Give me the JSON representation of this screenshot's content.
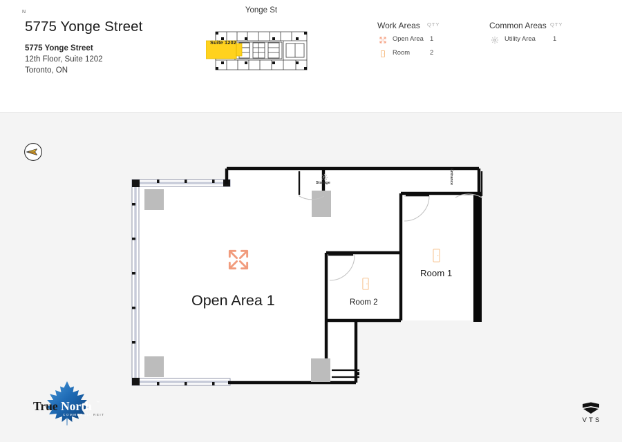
{
  "header": {
    "property_title": "5775 Yonge Street",
    "address": {
      "line1": "5775 Yonge Street",
      "line2": "12th Floor, Suite 1202",
      "line3": "Toronto, ON"
    }
  },
  "keyplan": {
    "title": "Yonge St",
    "highlight_label": "Suite 1202",
    "highlight_color": "#FFD21E"
  },
  "legends": [
    {
      "id": "work-areas",
      "title": "Work Areas",
      "qty_header": "QTY",
      "rows": [
        {
          "icon": "expand-arrows-icon",
          "label": "Open Area",
          "qty": "1",
          "color": "#F5A183"
        },
        {
          "icon": "door-room-icon",
          "label": "Room",
          "qty": "2",
          "color": "#F7C08A"
        }
      ]
    },
    {
      "id": "common-areas",
      "title": "Common Areas",
      "qty_header": "QTY",
      "rows": [
        {
          "icon": "gear-icon",
          "label": "Utility Area",
          "qty": "1",
          "color": "#9a9a9a"
        }
      ]
    }
  ],
  "compass": {
    "label": "N"
  },
  "floorplan": {
    "spaces": [
      {
        "name": "Open Area 1",
        "icon": "expand-arrows-icon",
        "type": "open-area"
      },
      {
        "name": "Room 1",
        "icon": "door-room-icon",
        "type": "room"
      },
      {
        "name": "Room 2",
        "icon": "door-room-icon",
        "type": "room"
      },
      {
        "name": "Storage",
        "icon": "gear-icon",
        "type": "utility-area"
      }
    ],
    "entrance_label": "Entrance"
  },
  "logos": {
    "brand_name_1": "True",
    "brand_name_2": "North",
    "brand_tagline": "COMMERCIAL REIT",
    "brand_tm": "™",
    "vts_wordmark": "VTS"
  },
  "colors": {
    "accent_salmon": "#F5A183",
    "accent_orange": "#F7C08A",
    "highlight_yellow": "#FFD21E",
    "brand_blue": "#1B63A8",
    "page_bg": "#f4f4f4",
    "header_bg": "#ffffff"
  }
}
